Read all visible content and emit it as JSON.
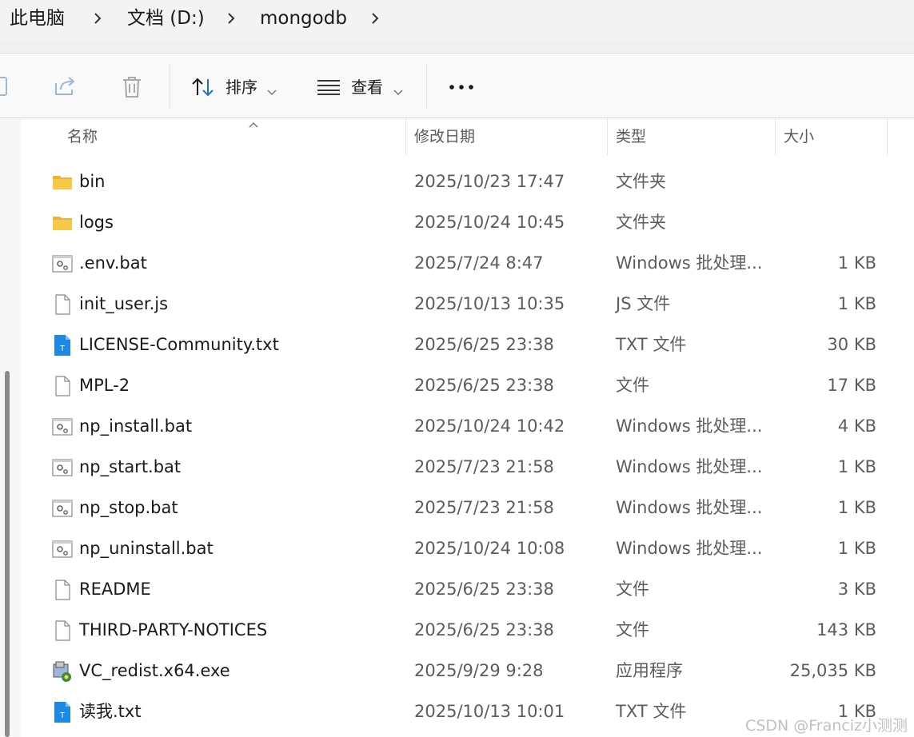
{
  "breadcrumb": {
    "items": [
      "此电脑",
      "文档 (D:)",
      "mongodb"
    ]
  },
  "toolbar": {
    "sort_label": "排序",
    "view_label": "查看",
    "more_label": "•••"
  },
  "columns": {
    "name": "名称",
    "date": "修改日期",
    "type": "类型",
    "size": "大小"
  },
  "files": [
    {
      "name": "bin",
      "date": "2025/10/23 17:47",
      "type": "文件夹",
      "size": "",
      "icon": "folder-icon"
    },
    {
      "name": "logs",
      "date": "2025/10/24 10:45",
      "type": "文件夹",
      "size": "",
      "icon": "folder-icon"
    },
    {
      "name": ".env.bat",
      "date": "2025/7/24 8:47",
      "type": "Windows 批处理...",
      "size": "1 KB",
      "icon": "batch-file-icon"
    },
    {
      "name": "init_user.js",
      "date": "2025/10/13 10:35",
      "type": "JS 文件",
      "size": "1 KB",
      "icon": "blank-file-icon"
    },
    {
      "name": "LICENSE-Community.txt",
      "date": "2025/6/25 23:38",
      "type": "TXT 文件",
      "size": "30 KB",
      "icon": "text-file-icon"
    },
    {
      "name": "MPL-2",
      "date": "2025/6/25 23:38",
      "type": "文件",
      "size": "17 KB",
      "icon": "blank-file-icon"
    },
    {
      "name": "np_install.bat",
      "date": "2025/10/24 10:42",
      "type": "Windows 批处理...",
      "size": "4 KB",
      "icon": "batch-file-icon"
    },
    {
      "name": "np_start.bat",
      "date": "2025/7/23 21:58",
      "type": "Windows 批处理...",
      "size": "1 KB",
      "icon": "batch-file-icon"
    },
    {
      "name": "np_stop.bat",
      "date": "2025/7/23 21:58",
      "type": "Windows 批处理...",
      "size": "1 KB",
      "icon": "batch-file-icon"
    },
    {
      "name": "np_uninstall.bat",
      "date": "2025/10/24 10:08",
      "type": "Windows 批处理...",
      "size": "1 KB",
      "icon": "batch-file-icon"
    },
    {
      "name": "README",
      "date": "2025/6/25 23:38",
      "type": "文件",
      "size": "3 KB",
      "icon": "blank-file-icon"
    },
    {
      "name": "THIRD-PARTY-NOTICES",
      "date": "2025/6/25 23:38",
      "type": "文件",
      "size": "143 KB",
      "icon": "blank-file-icon"
    },
    {
      "name": "VC_redist.x64.exe",
      "date": "2025/9/29 9:28",
      "type": "应用程序",
      "size": "25,035 KB",
      "icon": "installer-icon"
    },
    {
      "name": "读我.txt",
      "date": "2025/10/13 10:01",
      "type": "TXT 文件",
      "size": "1 KB",
      "icon": "text-file-icon"
    }
  ],
  "watermark": "CSDN @Franciz小测测",
  "colors": {
    "folder": "#f7c948",
    "text_file_accent": "#1e88e5",
    "toolbar_bg": "#f9f9f9",
    "header_text": "#5a5a5a"
  }
}
